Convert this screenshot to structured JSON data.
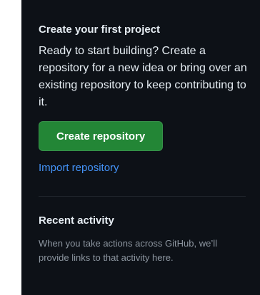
{
  "first_project": {
    "title": "Create your first project",
    "description": "Ready to start building? Create a repository for a new idea or bring over an existing repository to keep contributing to it.",
    "create_button_label": "Create repository",
    "import_link_label": "Import repository"
  },
  "recent_activity": {
    "title": "Recent activity",
    "description": "When you take actions across GitHub, we’ll provide links to that activity here."
  },
  "colors": {
    "background": "#0d1117",
    "primary_button": "#238636",
    "link": "#4493f8",
    "muted_text": "#8d96a0"
  }
}
